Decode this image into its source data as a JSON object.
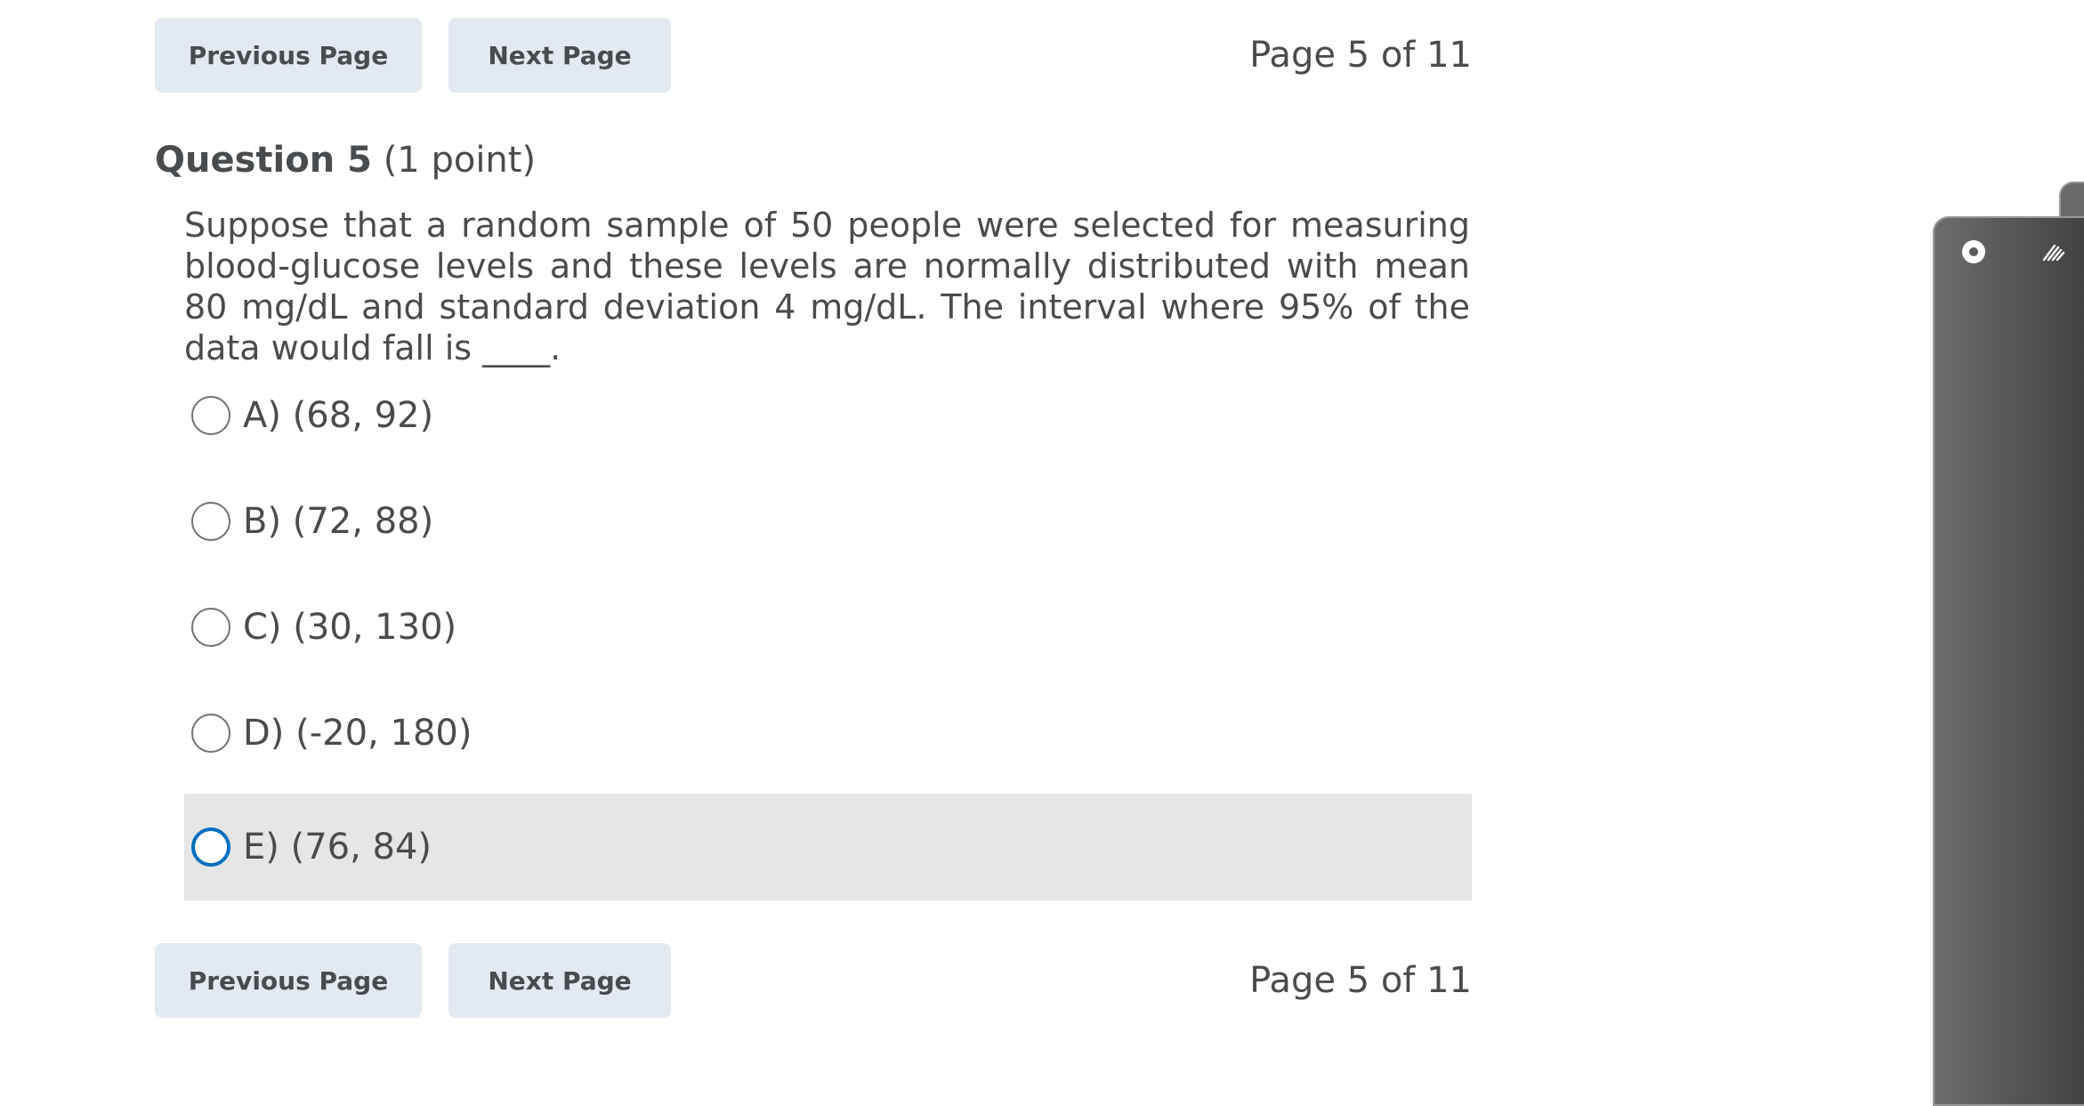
{
  "navigation": {
    "previous_label": "Previous Page",
    "next_label": "Next Page",
    "page_indicator": "Page 5 of 11"
  },
  "question": {
    "number_label": "Question 5",
    "points_label": "(1 point)",
    "text": "Suppose that a random sample of 50 people were selected for measuring blood-glucose levels and these levels are normally distributed with mean 80 mg/dL and standard deviation 4 mg/dL. The interval where 95% of the data would fall is ____.",
    "options": [
      {
        "label": "A) (68, 92)",
        "selected": false
      },
      {
        "label": "B) (72, 88)",
        "selected": false
      },
      {
        "label": "C) (30, 130)",
        "selected": false
      },
      {
        "label": "D) (-20, 180)",
        "selected": false
      },
      {
        "label": "E) (76, 84)",
        "selected": false,
        "hovered": true
      }
    ]
  },
  "side_panel": {
    "icons": [
      "record-dot-icon",
      "pen-icon"
    ]
  },
  "colors": {
    "button_bg": "#e3e9f1",
    "text": "#494c4e",
    "focus_ring": "#006fbf",
    "hover_bg": "#e6e6e6"
  }
}
